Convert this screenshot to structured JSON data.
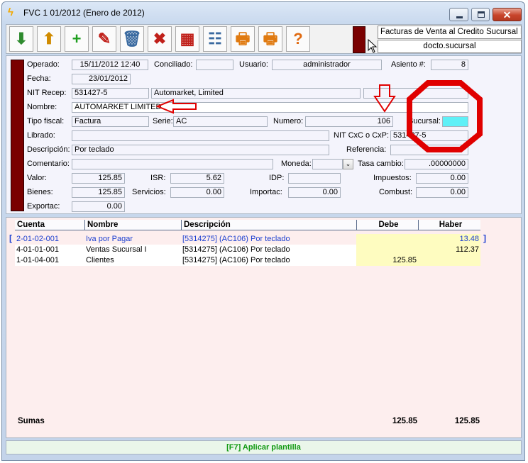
{
  "window": {
    "title": "FVC 1 01/2012 (Enero de 2012)",
    "close_glyph": "✕"
  },
  "toolbar": {
    "buttons": [
      {
        "name": "download-icon",
        "glyph": "⬇",
        "color": "#2e8b2e"
      },
      {
        "name": "upload-icon",
        "glyph": "⬆",
        "color": "#d08b00"
      },
      {
        "name": "new-document-icon",
        "glyph": "+",
        "color": "#1e9e1e"
      },
      {
        "name": "edit-pencil-icon",
        "glyph": "✎",
        "color": "#c0201a"
      },
      {
        "name": "delete-trash-icon",
        "glyph": "🗑",
        "color": "#3a6aa0"
      },
      {
        "name": "cancel-document-icon",
        "glyph": "✖",
        "color": "#c0201a"
      },
      {
        "name": "grid-delete-icon",
        "glyph": "▦",
        "color": "#c0201a"
      },
      {
        "name": "contact-card-icon",
        "glyph": "☷",
        "color": "#3a6aa0"
      },
      {
        "name": "print-icon",
        "glyph": "🖶",
        "color": "#e07a10"
      },
      {
        "name": "print-preview-icon",
        "glyph": "🖶",
        "color": "#e07a10"
      },
      {
        "name": "help-icon",
        "glyph": "?",
        "color": "#e06a10"
      }
    ],
    "report_title": "Facturas de Venta al Credito Sucursal I",
    "report_subtitle": "docto.sucursal"
  },
  "header": {
    "operado_label": "Operado:",
    "operado_value": "15/11/2012 12:40",
    "conciliado_label": "Conciliado:",
    "conciliado_value": "",
    "usuario_label": "Usuario:",
    "usuario_value": "administrador",
    "asiento_label": "Asiento #:",
    "asiento_value": "8",
    "fecha_label": "Fecha:",
    "fecha_value": "23/01/2012",
    "nit_label": "NIT Recep:",
    "nit_value": "531427-5",
    "nit_name": "Automarket, Limited",
    "nit_extra": "",
    "nombre_label": "Nombre:",
    "nombre_value": "AUTOMARKET LIMITED",
    "tipo_fiscal_label": "Tipo fiscal:",
    "tipo_fiscal_value": "Factura",
    "serie_label": "Serie:",
    "serie_value": "AC",
    "numero_label": "Numero:",
    "numero_value": "106",
    "sucursal_label": "Sucursal:",
    "sucursal_value": "",
    "librado_label": "Librado:",
    "librado_value": "",
    "nit_cxc_label": "NIT CxC o CxP:",
    "nit_cxc_value": "531427-5",
    "descripcion_label": "Descripción:",
    "descripcion_value": "Por teclado",
    "referencia_label": "Referencia:",
    "referencia_value": "",
    "comentario_label": "Comentario:",
    "comentario_value": "",
    "moneda_label": "Moneda:",
    "moneda_value": "",
    "moneda_arrow": "⌄",
    "tasa_label": "Tasa cambio:",
    "tasa_value": ".00000000",
    "valor_label": "Valor:",
    "valor_value": "125.85",
    "isr_label": "ISR:",
    "isr_value": "5.62",
    "idp_label": "IDP:",
    "idp_value": "",
    "impuestos_label": "Impuestos:",
    "impuestos_value": "0.00",
    "bienes_label": "Bienes:",
    "bienes_value": "125.85",
    "servicios_label": "Servicios:",
    "servicios_value": "0.00",
    "importac_label": "Importac:",
    "importac_value": "0.00",
    "combust_label": "Combust:",
    "combust_value": "0.00",
    "exportac_label": "Exportac:",
    "exportac_value": "0.00"
  },
  "grid": {
    "columns": [
      "Cuenta",
      "Nombre",
      "Descripción",
      "Debe",
      "Haber"
    ],
    "rows": [
      {
        "cuenta": "2-01-02-001",
        "nombre": "Iva por Pagar",
        "descripcion": "[5314275] (AC106) Por teclado",
        "debe": "",
        "haber": "13.48"
      },
      {
        "cuenta": "4-01-01-001",
        "nombre": "Ventas Sucursal I",
        "descripcion": "[5314275] (AC106) Por teclado",
        "debe": "",
        "haber": "112.37"
      },
      {
        "cuenta": "1-01-04-001",
        "nombre": "Clientes",
        "descripcion": "[5314275] (AC106) Por teclado",
        "debe": "125.85",
        "haber": ""
      }
    ],
    "selected_row_color": "#1c3fd0",
    "bracket_left": "[",
    "bracket_right": "]",
    "sumas_label": "Sumas",
    "sumas_debe": "125.85",
    "sumas_haber": "125.85"
  },
  "status": {
    "text": "[F7] Aplicar plantilla"
  },
  "colors": {
    "annotation_red": "#e00000",
    "sucursal_cyan": "#5ff0f7",
    "side_bar": "#7a0000"
  }
}
